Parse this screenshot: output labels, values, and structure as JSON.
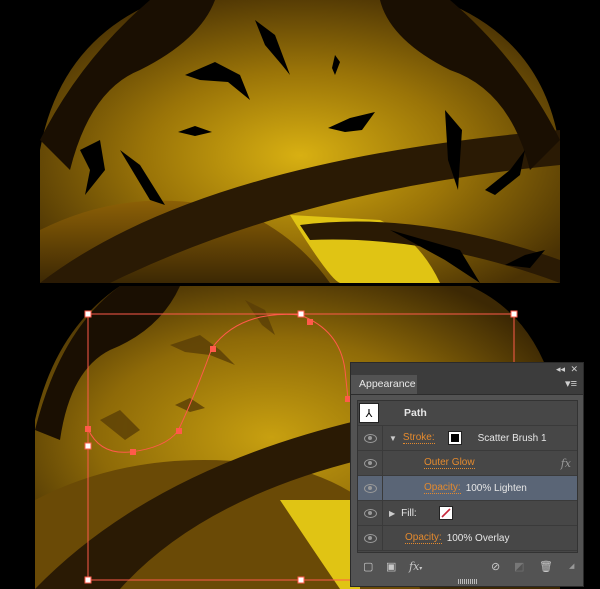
{
  "panel": {
    "tab_label": "Appearance",
    "collapse_icon": "double-chevron-left-icon",
    "close_icon": "close-icon",
    "menu_icon": "panel-menu-icon",
    "object_type": "Path",
    "rows": [
      {
        "kind": "stroke",
        "label": "Stroke:",
        "value": "Scatter Brush 1",
        "expanded": true,
        "swatch_color": "#000000"
      },
      {
        "kind": "effect",
        "label": "Outer Glow",
        "fx": "fx"
      },
      {
        "kind": "opacity",
        "label": "Opacity:",
        "value": "100% Lighten",
        "selected": true
      },
      {
        "kind": "fill",
        "label": "Fill:",
        "expanded": false,
        "swatch": "none"
      },
      {
        "kind": "opacity",
        "label": "Opacity:",
        "value": "100% Overlay"
      }
    ],
    "toolbar": {
      "add_stroke": "add-new-stroke-icon",
      "add_fill": "add-new-fill-icon",
      "add_effect": "fx",
      "clear": "clear-appearance-icon",
      "duplicate": "duplicate-item-icon",
      "delete": "trash-icon"
    }
  },
  "colors": {
    "accent_label": "#e48a2e",
    "selection": "#ff5a4a",
    "selected_row": "#5a6576",
    "none_slash": "#c8283c"
  }
}
